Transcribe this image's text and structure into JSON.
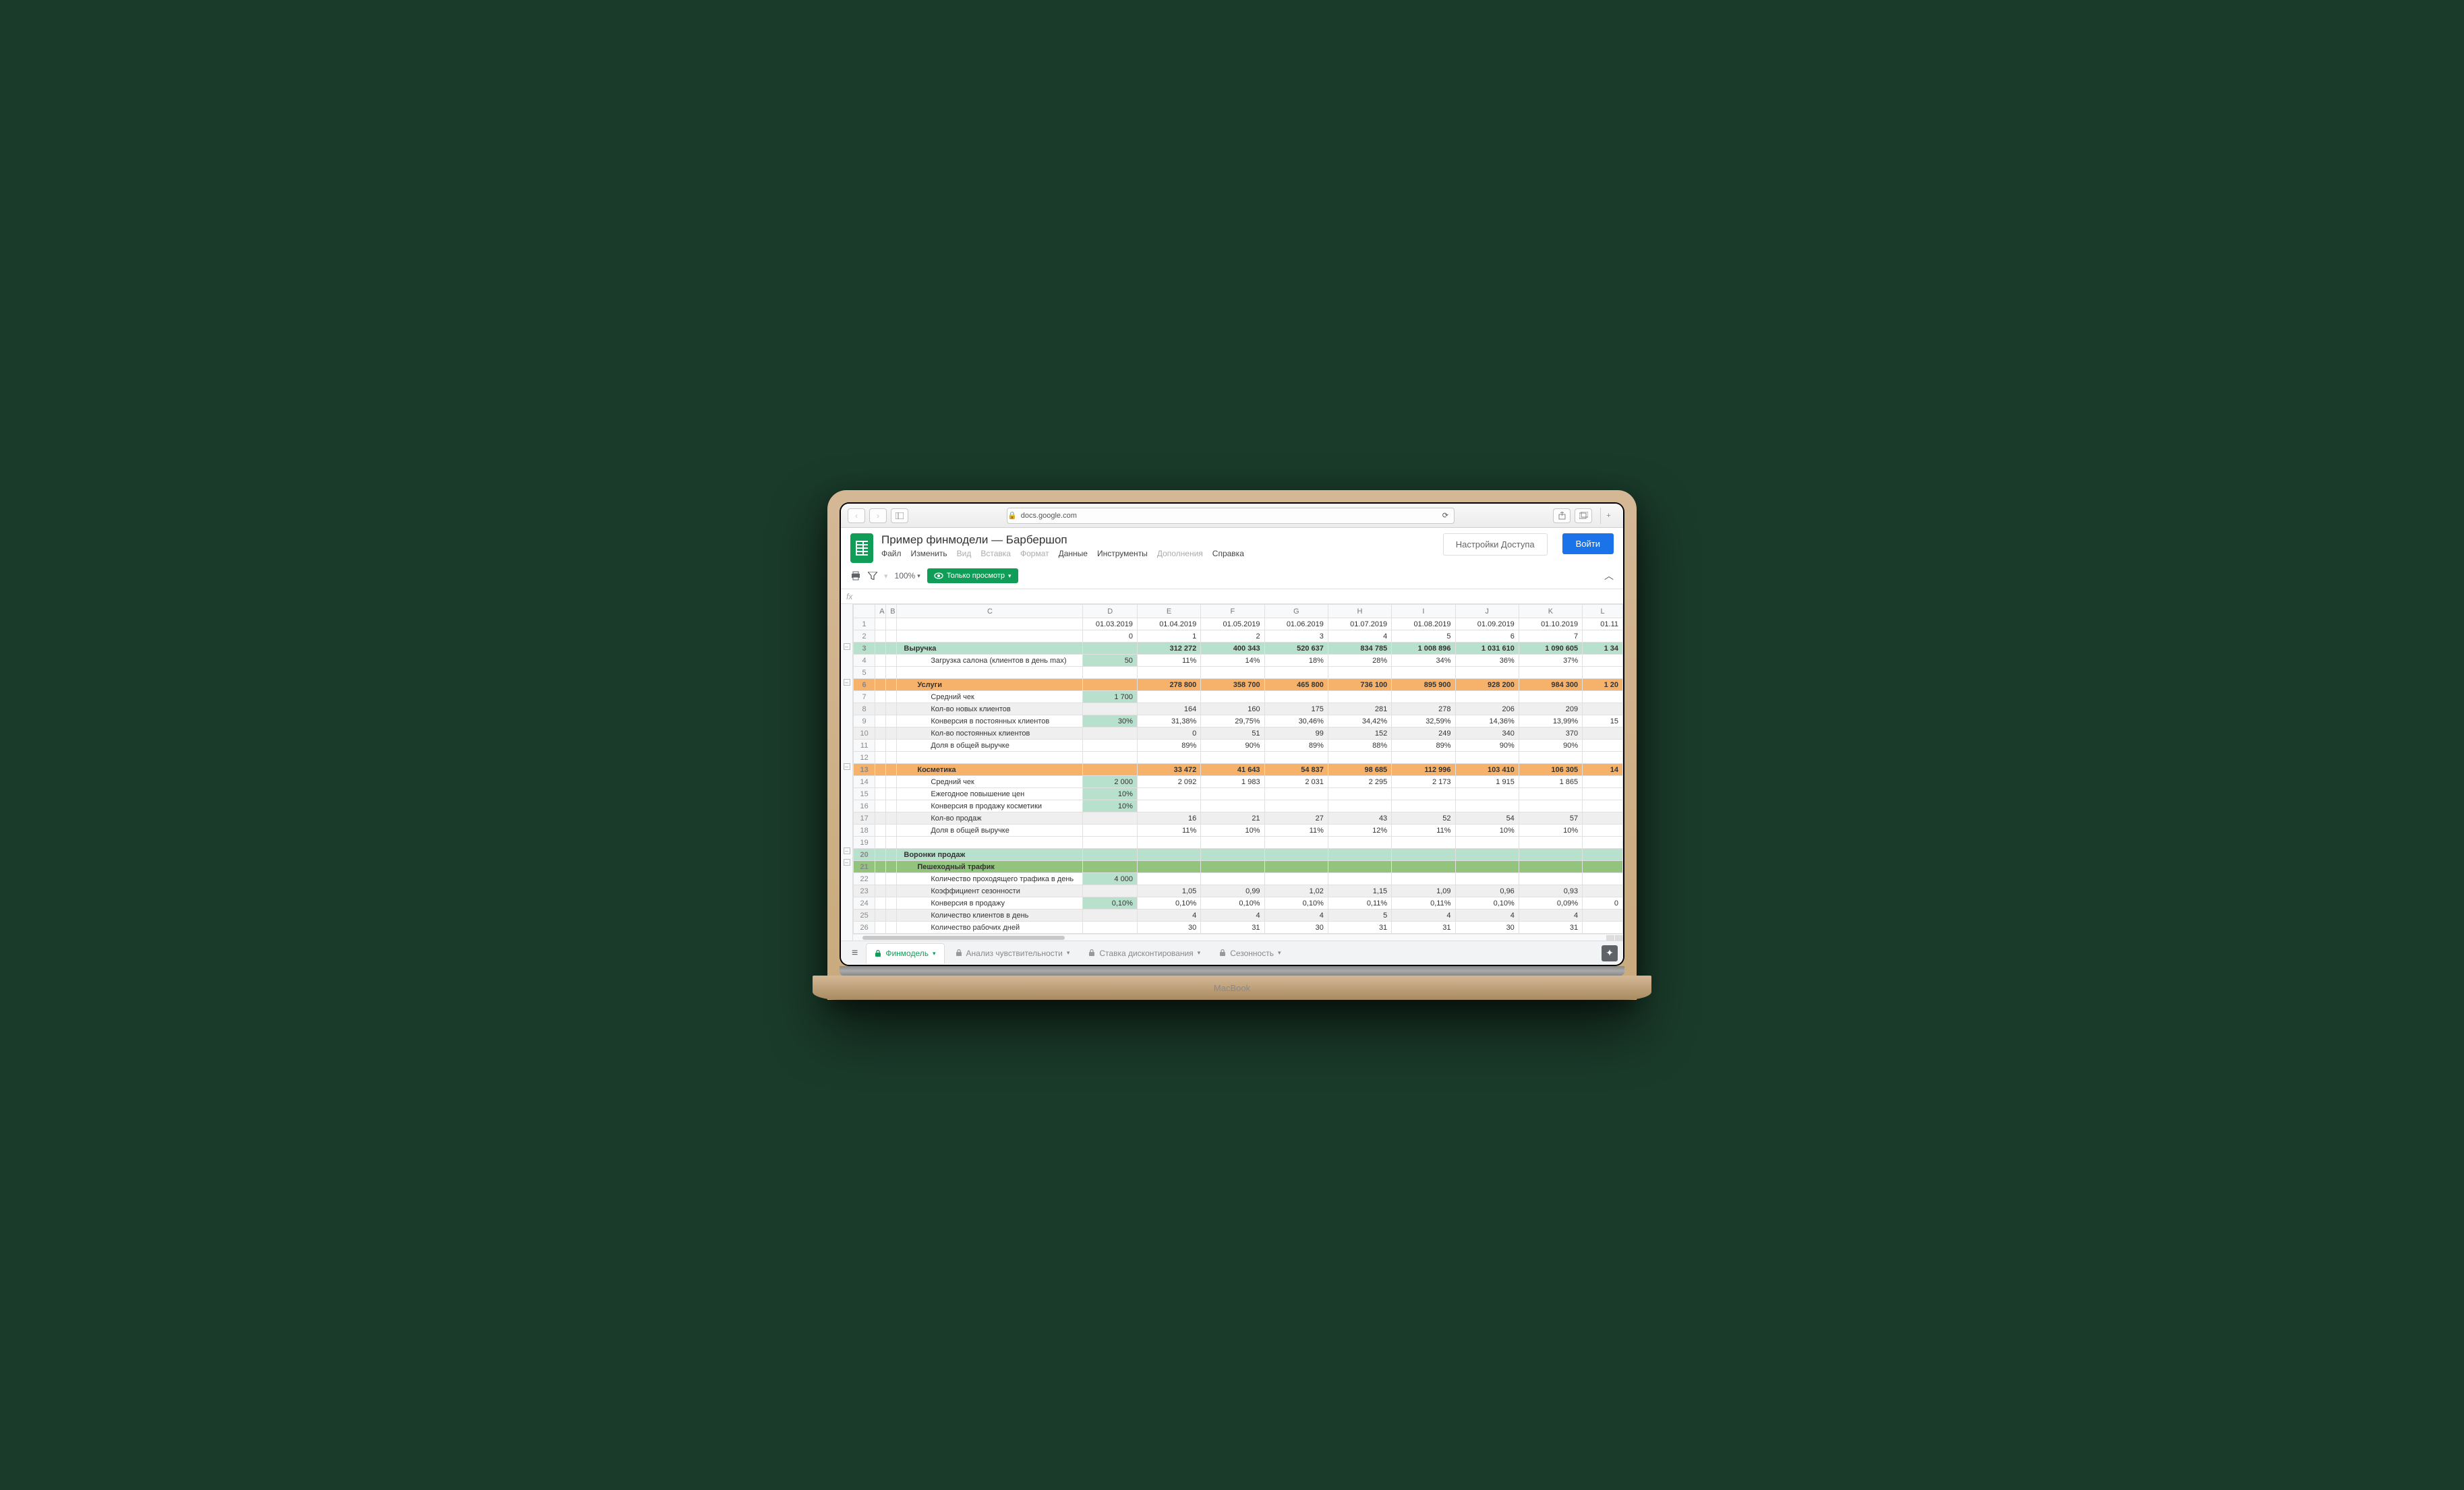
{
  "browser": {
    "url_host": "docs.google.com",
    "lock": "🔒"
  },
  "doc": {
    "title": "Пример финмодели — Барбершоп",
    "menus": [
      "Файл",
      "Изменить",
      "Вид",
      "Вставка",
      "Формат",
      "Данные",
      "Инструменты",
      "Дополнения",
      "Справка"
    ],
    "share": "Настройки Доступа",
    "login": "Войти",
    "zoom": "100%",
    "viewonly": "Только просмотр",
    "fx": "fx"
  },
  "columns": [
    "",
    "A",
    "B",
    "C",
    "D",
    "E",
    "F",
    "G",
    "H",
    "I",
    "J",
    "K",
    "L"
  ],
  "rows": [
    {
      "n": 1,
      "cells": [
        "",
        "",
        "",
        "",
        "01.03.2019",
        "01.04.2019",
        "01.05.2019",
        "01.06.2019",
        "01.07.2019",
        "01.08.2019",
        "01.09.2019",
        "01.10.2019",
        "01.11"
      ]
    },
    {
      "n": 2,
      "cells": [
        "",
        "",
        "",
        "",
        "0",
        "1",
        "2",
        "3",
        "4",
        "5",
        "6",
        "7",
        ""
      ]
    },
    {
      "n": 3,
      "style": "hdr-green",
      "cells": [
        "",
        "",
        "",
        "Выручка",
        "",
        "312 272",
        "400 343",
        "520 637",
        "834 785",
        "1 008 896",
        "1 031 610",
        "1 090 605",
        "1 34"
      ],
      "labelcol": "lvl1"
    },
    {
      "n": 4,
      "cells": [
        "",
        "",
        "",
        "Загрузка салона (клиентов в день max)",
        {
          "v": "50",
          "cls": "inp"
        },
        "11%",
        "14%",
        "18%",
        "28%",
        "34%",
        "36%",
        "37%",
        ""
      ],
      "labelcol": "lvl3"
    },
    {
      "n": 5,
      "cells": [
        "",
        "",
        "",
        "",
        "",
        "",
        "",
        "",
        "",
        "",
        "",
        "",
        ""
      ]
    },
    {
      "n": 6,
      "style": "hdr-orange",
      "cells": [
        "",
        "",
        "",
        "Услуги",
        "",
        "278 800",
        "358 700",
        "465 800",
        "736 100",
        "895 900",
        "928 200",
        "984 300",
        "1 20"
      ],
      "labelcol": "lvl2"
    },
    {
      "n": 7,
      "cells": [
        "",
        "",
        "",
        "Средний чек",
        {
          "v": "1 700",
          "cls": "inp"
        },
        "",
        "",
        "",
        "",
        "",
        "",
        "",
        ""
      ],
      "labelcol": "lvl3"
    },
    {
      "n": 8,
      "style": "gray",
      "cells": [
        "",
        "",
        "",
        "Кол-во новых клиентов",
        "",
        "164",
        "160",
        "175",
        "281",
        "278",
        "206",
        "209",
        ""
      ],
      "labelcol": "lvl3"
    },
    {
      "n": 9,
      "cells": [
        "",
        "",
        "",
        "Конверсия в постоянных клиентов",
        {
          "v": "30%",
          "cls": "inp"
        },
        "31,38%",
        "29,75%",
        "30,46%",
        "34,42%",
        "32,59%",
        "14,36%",
        "13,99%",
        "15"
      ],
      "labelcol": "lvl3"
    },
    {
      "n": 10,
      "style": "gray",
      "cells": [
        "",
        "",
        "",
        "Кол-во постоянных клиентов",
        "",
        "0",
        "51",
        "99",
        "152",
        "249",
        "340",
        "370",
        ""
      ],
      "labelcol": "lvl3"
    },
    {
      "n": 11,
      "cells": [
        "",
        "",
        "",
        "Доля в общей выручке",
        "",
        "89%",
        "90%",
        "89%",
        "88%",
        "89%",
        "90%",
        "90%",
        ""
      ],
      "labelcol": "lvl3"
    },
    {
      "n": 12,
      "cells": [
        "",
        "",
        "",
        "",
        "",
        "",
        "",
        "",
        "",
        "",
        "",
        "",
        ""
      ]
    },
    {
      "n": 13,
      "style": "hdr-orange",
      "cells": [
        "",
        "",
        "",
        "Косметика",
        "",
        "33 472",
        "41 643",
        "54 837",
        "98 685",
        "112 996",
        "103 410",
        "106 305",
        "14"
      ],
      "labelcol": "lvl2"
    },
    {
      "n": 14,
      "cells": [
        "",
        "",
        "",
        "Средний чек",
        {
          "v": "2 000",
          "cls": "inp"
        },
        "2 092",
        "1 983",
        "2 031",
        "2 295",
        "2 173",
        "1 915",
        "1 865",
        ""
      ],
      "labelcol": "lvl3"
    },
    {
      "n": 15,
      "cells": [
        "",
        "",
        "",
        "Ежегодное повышение цен",
        {
          "v": "10%",
          "cls": "inp"
        },
        "",
        "",
        "",
        "",
        "",
        "",
        "",
        ""
      ],
      "labelcol": "lvl3"
    },
    {
      "n": 16,
      "cells": [
        "",
        "",
        "",
        "Конверсия в продажу косметики",
        {
          "v": "10%",
          "cls": "inp"
        },
        "",
        "",
        "",
        "",
        "",
        "",
        "",
        ""
      ],
      "labelcol": "lvl3"
    },
    {
      "n": 17,
      "style": "gray",
      "cells": [
        "",
        "",
        "",
        "Кол-во продаж",
        "",
        "16",
        "21",
        "27",
        "43",
        "52",
        "54",
        "57",
        ""
      ],
      "labelcol": "lvl3"
    },
    {
      "n": 18,
      "cells": [
        "",
        "",
        "",
        "Доля в общей выручке",
        "",
        "11%",
        "10%",
        "11%",
        "12%",
        "11%",
        "10%",
        "10%",
        ""
      ],
      "labelcol": "lvl3"
    },
    {
      "n": 19,
      "cells": [
        "",
        "",
        "",
        "",
        "",
        "",
        "",
        "",
        "",
        "",
        "",
        "",
        ""
      ]
    },
    {
      "n": 20,
      "style": "hdr-green",
      "cells": [
        "",
        "",
        "",
        "Воронки продаж",
        "",
        "",
        "",
        "",
        "",
        "",
        "",
        "",
        ""
      ],
      "labelcol": "lvl1"
    },
    {
      "n": 21,
      "style": "sub-green",
      "cells": [
        "",
        "",
        "",
        "Пешеходный трафик",
        "",
        "",
        "",
        "",
        "",
        "",
        "",
        "",
        ""
      ],
      "labelcol": "lvl2"
    },
    {
      "n": 22,
      "cells": [
        "",
        "",
        "",
        "Количество проходящего трафика в день",
        {
          "v": "4 000",
          "cls": "inp"
        },
        "",
        "",
        "",
        "",
        "",
        "",
        "",
        ""
      ],
      "labelcol": "lvl3"
    },
    {
      "n": 23,
      "style": "gray",
      "cells": [
        "",
        "",
        "",
        "Коэффициент сезонности",
        "",
        {
          "v": "1,05",
          "cls": "inp-row"
        },
        {
          "v": "0,99",
          "cls": "inp-row"
        },
        {
          "v": "1,02",
          "cls": "inp-row"
        },
        {
          "v": "1,15",
          "cls": "inp-row"
        },
        {
          "v": "1,09",
          "cls": "inp-row"
        },
        {
          "v": "0,96",
          "cls": "inp-row"
        },
        {
          "v": "0,93",
          "cls": "inp-row"
        },
        ""
      ],
      "labelcol": "lvl3"
    },
    {
      "n": 24,
      "cells": [
        "",
        "",
        "",
        "Конверсия в продажу",
        {
          "v": "0,10%",
          "cls": "inp"
        },
        "0,10%",
        "0,10%",
        "0,10%",
        "0,11%",
        "0,11%",
        "0,10%",
        "0,09%",
        "0"
      ],
      "labelcol": "lvl3"
    },
    {
      "n": 25,
      "style": "gray",
      "cells": [
        "",
        "",
        "",
        "Количество клиентов в день",
        "",
        "4",
        "4",
        "4",
        "5",
        "4",
        "4",
        "4",
        ""
      ],
      "labelcol": "lvl3"
    },
    {
      "n": 26,
      "cells": [
        "",
        "",
        "",
        "Количество рабочих дней",
        "",
        "30",
        "31",
        "30",
        "31",
        "31",
        "30",
        "31",
        ""
      ],
      "labelcol": "lvl3"
    }
  ],
  "tabs": [
    {
      "label": "Финмодель",
      "active": true
    },
    {
      "label": "Анализ чувствительности",
      "active": false
    },
    {
      "label": "Ставка дисконтирования",
      "active": false
    },
    {
      "label": "Сезонность",
      "active": false
    }
  ],
  "macbook": "MacBook"
}
